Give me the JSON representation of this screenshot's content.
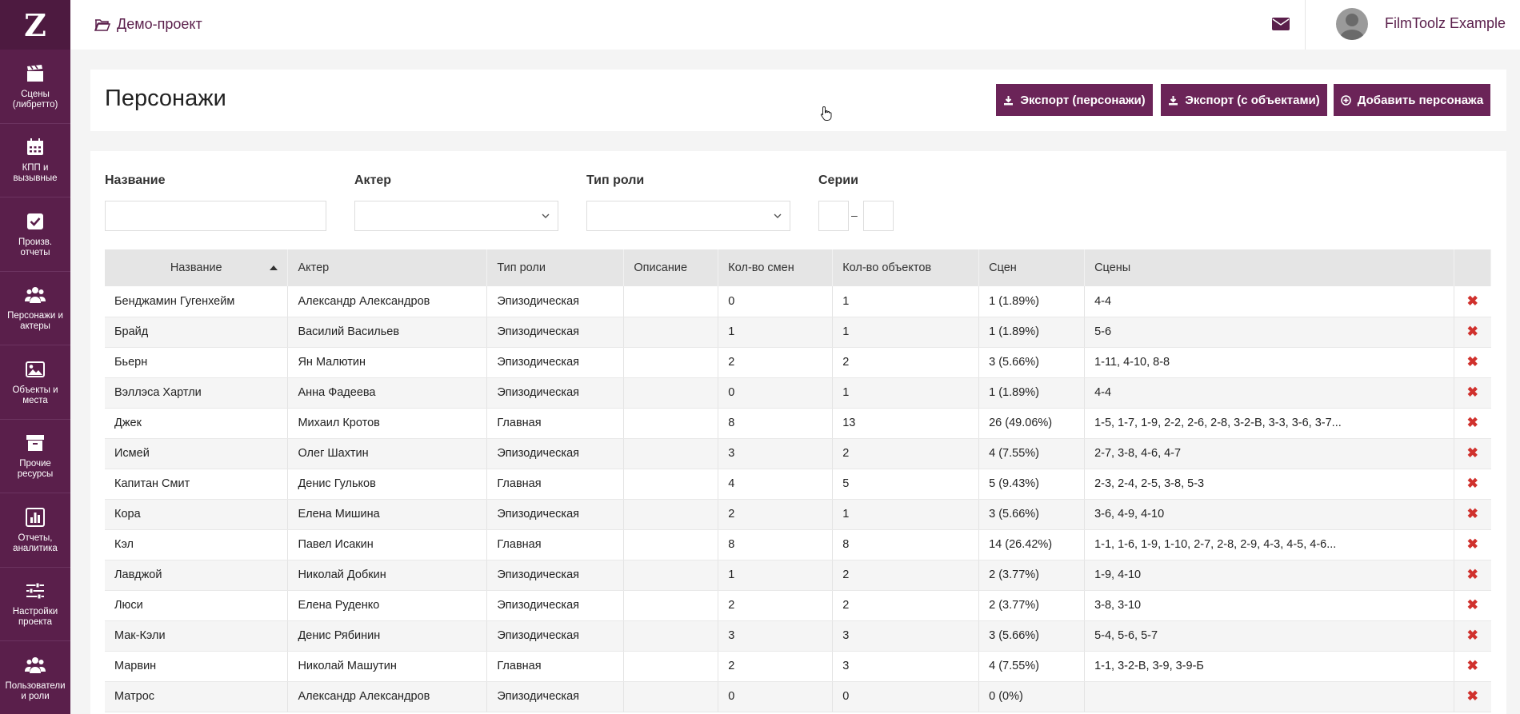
{
  "app": {
    "logo": "Z"
  },
  "sidebar": {
    "items": [
      {
        "label": "Сцены (либретто)",
        "icon": "clapperboard-icon"
      },
      {
        "label": "КПП и вызывные",
        "icon": "calendar-icon"
      },
      {
        "label": "Произв. отчеты",
        "icon": "checkbox-icon"
      },
      {
        "label": "Персонажи и актеры",
        "icon": "users-icon"
      },
      {
        "label": "Объекты и места",
        "icon": "image-icon"
      },
      {
        "label": "Прочие ресурсы",
        "icon": "archive-icon"
      },
      {
        "label": "Отчеты, аналитика",
        "icon": "bar-chart-icon"
      },
      {
        "label": "Настройки проекта",
        "icon": "sliders-icon"
      },
      {
        "label": "Пользователи и роли",
        "icon": "users-icon"
      }
    ]
  },
  "topbar": {
    "project": "Демо-проект",
    "username": "FilmToolz Example"
  },
  "header": {
    "title": "Персонажи",
    "export_characters": "Экспорт (персонажи)",
    "export_objects": "Экспорт (с объектами)",
    "add_character": "Добавить персонажа"
  },
  "filters": {
    "name_label": "Название",
    "actor_label": "Актер",
    "role_label": "Тип роли",
    "series_label": "Серии",
    "dash": "–"
  },
  "table": {
    "columns": [
      "Название",
      "Актер",
      "Тип роли",
      "Описание",
      "Кол-во смен",
      "Кол-во объектов",
      "Сцен",
      "Сцены"
    ],
    "rows": [
      [
        "Бенджамин Гугенхейм",
        "Александр Александров",
        "Эпизодическая",
        "",
        "0",
        "1",
        "1 (1.89%)",
        "4-4"
      ],
      [
        "Брайд",
        "Василий Васильев",
        "Эпизодическая",
        "",
        "1",
        "1",
        "1 (1.89%)",
        "5-6"
      ],
      [
        "Бьерн",
        "Ян Малютин",
        "Эпизодическая",
        "",
        "2",
        "2",
        "3 (5.66%)",
        "1-11, 4-10, 8-8"
      ],
      [
        "Вэллэса Хартли",
        "Анна Фадеева",
        "Эпизодическая",
        "",
        "0",
        "1",
        "1 (1.89%)",
        "4-4"
      ],
      [
        "Джек",
        "Михаил Кротов",
        "Главная",
        "",
        "8",
        "13",
        "26 (49.06%)",
        "1-5, 1-7, 1-9, 2-2, 2-6, 2-8, 3-2-В, 3-3, 3-6, 3-7..."
      ],
      [
        "Исмей",
        "Олег Шахтин",
        "Эпизодическая",
        "",
        "3",
        "2",
        "4 (7.55%)",
        "2-7, 3-8, 4-6, 4-7"
      ],
      [
        "Капитан Смит",
        "Денис Гульков",
        "Главная",
        "",
        "4",
        "5",
        "5 (9.43%)",
        "2-3, 2-4, 2-5, 3-8, 5-3"
      ],
      [
        "Кора",
        "Елена Мишина",
        "Эпизодическая",
        "",
        "2",
        "1",
        "3 (5.66%)",
        "3-6, 4-9, 4-10"
      ],
      [
        "Кэл",
        "Павел Исакин",
        "Главная",
        "",
        "8",
        "8",
        "14 (26.42%)",
        "1-1, 1-6, 1-9, 1-10, 2-7, 2-8, 2-9, 4-3, 4-5, 4-6..."
      ],
      [
        "Лавджой",
        "Николай Добкин",
        "Эпизодическая",
        "",
        "1",
        "2",
        "2 (3.77%)",
        "1-9, 4-10"
      ],
      [
        "Люси",
        "Елена Руденко",
        "Эпизодическая",
        "",
        "2",
        "2",
        "2 (3.77%)",
        "3-8, 3-10"
      ],
      [
        "Мак-Кэли",
        "Денис Рябинин",
        "Эпизодическая",
        "",
        "3",
        "3",
        "3 (5.66%)",
        "5-4, 5-6, 5-7"
      ],
      [
        "Марвин",
        "Николай Машутин",
        "Главная",
        "",
        "2",
        "3",
        "4 (7.55%)",
        "1-1, 3-2-В, 3-9, 3-9-Б"
      ],
      [
        "Матрос",
        "Александр Александров",
        "Эпизодическая",
        "",
        "0",
        "0",
        "0 (0%)",
        ""
      ]
    ]
  },
  "colors": {
    "brand": "#5a1f4b",
    "button": "#6b2458",
    "delete": "#d0312d"
  }
}
